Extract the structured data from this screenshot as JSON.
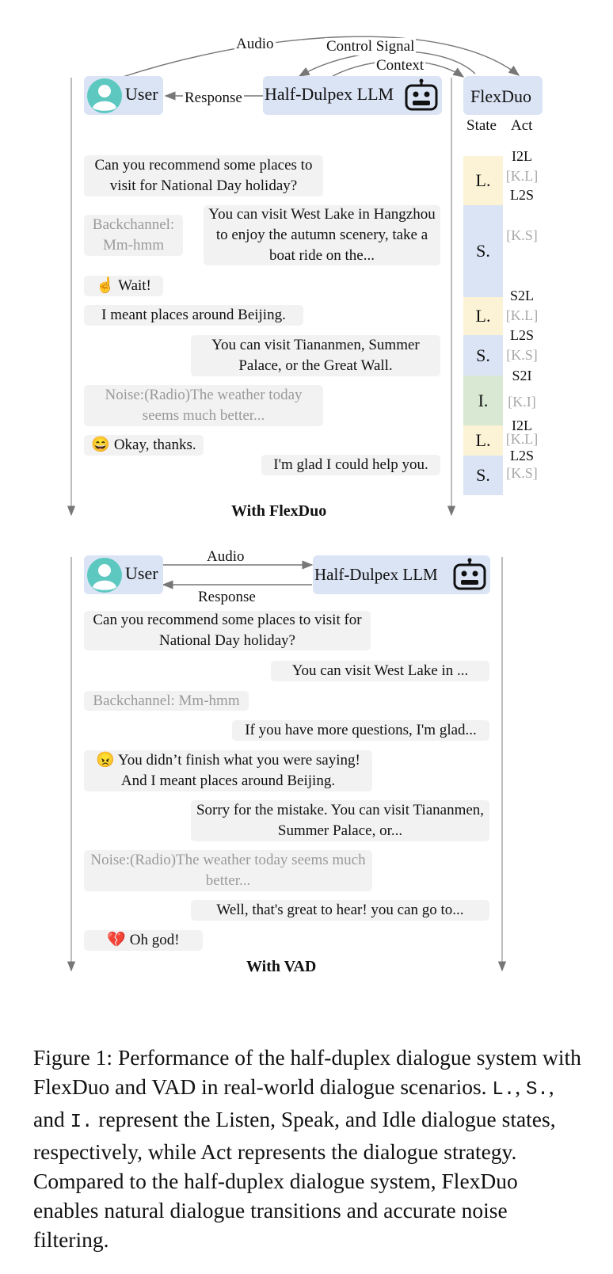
{
  "top": {
    "user_label": "User",
    "llm_label": "Half-Dulpex LLM",
    "flexduo_label": "FlexDuo",
    "arrow_audio": "Audio",
    "arrow_control": "Control Signal",
    "arrow_context": "Context",
    "arrow_response": "Response",
    "col_state": "State",
    "col_act": "Act",
    "messages": [
      "Can you recommend some places to visit for  National Day holiday?",
      "Backchannel: Mm-hmm",
      "You can visit West Lake in Hangzhou to enjoy the autumn scenery, take a boat ride on the...",
      "☝ Wait!",
      "I meant places around Beijing.",
      "You can visit Tiananmen, Summer Palace, or the Great Wall.",
      "Noise:(Radio)The weather today seems much better...",
      "😄 Okay, thanks.",
      "I'm glad I could help you."
    ],
    "states": [
      "L.",
      "S.",
      "L.",
      "S.",
      "I.",
      "L.",
      "S."
    ],
    "state_colors": [
      "#fcf3d6",
      "#dbe4f5",
      "#fcf3d6",
      "#dbe4f5",
      "#d8e8d2",
      "#fcf3d6",
      "#dbe4f5"
    ],
    "acts": [
      "I2L",
      "[K.L]",
      "L2S",
      "[K.S]",
      "S2L",
      "[K.L]",
      "L2S",
      "[K.S]",
      "S2I",
      "[K.I]",
      "I2L",
      "[K.L]",
      "L2S",
      "[K.S]"
    ],
    "title": "With FlexDuo"
  },
  "bottom": {
    "user_label": "User",
    "llm_label": "Half-Dulpex LLM",
    "arrow_audio": "Audio",
    "arrow_response": "Response",
    "messages": [
      "Can you recommend some places to visit for  National Day holiday?",
      "You can visit West Lake in ...",
      "Backchannel: Mm-hmm",
      "If you have more questions, I'm glad...",
      "😠 You didn’t finish what you were saying! And I meant places around Beijing.",
      "Sorry for the mistake. You can visit Tiananmen, Summer Palace, or...",
      "Noise:(Radio)The weather today seems much better...",
      "Well, that's great to hear! you can go to...",
      "💔 Oh god!"
    ],
    "title": "With VAD"
  },
  "caption": {
    "p1": "Figure 1: Performance of the half-duplex dialogue system with FlexDuo and VAD in real-world dialogue scenarios. ",
    "c1": "L.",
    "p2": ", ",
    "c2": "S.",
    "p3": ", and ",
    "c3": "I.",
    "p4": " represent the Listen, Speak, and Idle dialogue states, respectively, while Act represents the dialogue strategy. Compared to the half-duplex dialogue system, FlexDuo enables natural dialogue transitions and accurate noise filtering."
  },
  "colors": {
    "pill": "#dbe4f5",
    "bubble": "#f2f2f2",
    "avatar": "#5cc8c0",
    "listen": "#fcf3d6",
    "speak": "#dbe4f5",
    "idle": "#d8e8d2"
  },
  "icons": [
    "user-avatar-icon",
    "robot-icon"
  ]
}
